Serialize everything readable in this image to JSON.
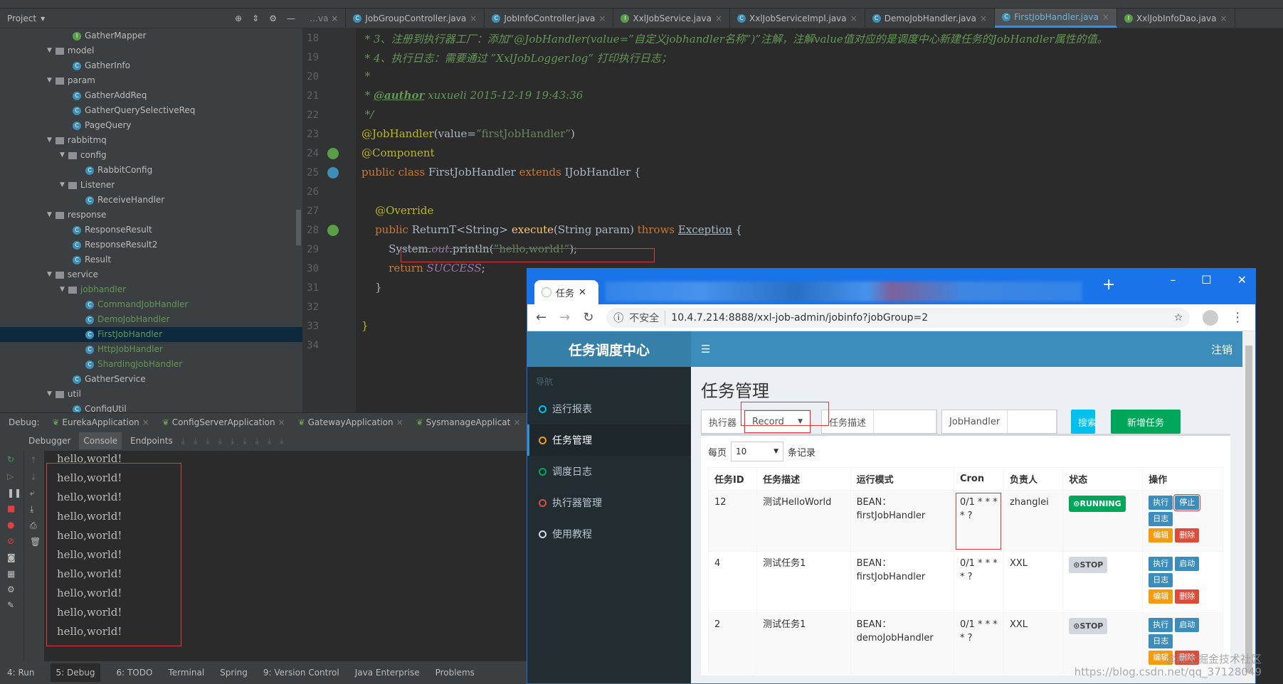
{
  "ide": {
    "project_label": "Project",
    "tree": [
      {
        "label": "GatherMapper",
        "kind": "interface",
        "depth": 3
      },
      {
        "label": "model",
        "kind": "folder",
        "depth": 2
      },
      {
        "label": "GatherInfo",
        "kind": "class",
        "depth": 3
      },
      {
        "label": "param",
        "kind": "folder",
        "depth": 2
      },
      {
        "label": "GatherAddReq",
        "kind": "class",
        "depth": 3
      },
      {
        "label": "GatherQuerySelectiveReq",
        "kind": "class",
        "depth": 3
      },
      {
        "label": "PageQuery",
        "kind": "class",
        "depth": 3
      },
      {
        "label": "rabbitmq",
        "kind": "folder",
        "depth": 2
      },
      {
        "label": "config",
        "kind": "folder",
        "depth": 3
      },
      {
        "label": "RabbitConfig",
        "kind": "class",
        "depth": 4
      },
      {
        "label": "Listener",
        "kind": "folder",
        "depth": 3
      },
      {
        "label": "ReceiveHandler",
        "kind": "class",
        "depth": 4
      },
      {
        "label": "response",
        "kind": "folder",
        "depth": 2
      },
      {
        "label": "ResponseResult",
        "kind": "class",
        "depth": 3
      },
      {
        "label": "ResponseResult2",
        "kind": "class",
        "depth": 3
      },
      {
        "label": "Result",
        "kind": "class",
        "depth": 3
      },
      {
        "label": "service",
        "kind": "folder",
        "depth": 2
      },
      {
        "label": "jobhandler",
        "kind": "folder",
        "depth": 3,
        "green": true
      },
      {
        "label": "CommandJobHandler",
        "kind": "class",
        "depth": 4,
        "green": true
      },
      {
        "label": "DemoJobHandler",
        "kind": "class",
        "depth": 4,
        "green": true
      },
      {
        "label": "FirstJobHandler",
        "kind": "class",
        "depth": 4,
        "green": true,
        "selected": true
      },
      {
        "label": "HttpJobHandler",
        "kind": "class",
        "depth": 4,
        "green": true
      },
      {
        "label": "ShardingJobHandler",
        "kind": "class",
        "depth": 4,
        "green": true
      },
      {
        "label": "GatherService",
        "kind": "class",
        "depth": 3
      },
      {
        "label": "util",
        "kind": "folder",
        "depth": 2
      },
      {
        "label": "ConfigUtil",
        "kind": "class",
        "depth": 3
      }
    ],
    "tabs": [
      {
        "label": "JobGroupController.java",
        "kind": "class"
      },
      {
        "label": "JobInfoController.java",
        "kind": "class"
      },
      {
        "label": "XxlJobService.java",
        "kind": "interface"
      },
      {
        "label": "XxlJobServiceImpl.java",
        "kind": "class"
      },
      {
        "label": "DemoJobHandler.java",
        "kind": "class"
      },
      {
        "label": "FirstJobHandler.java",
        "kind": "class",
        "active": true
      },
      {
        "label": "XxlJobInfoDao.java",
        "kind": "interface"
      }
    ],
    "code_lines": [
      {
        "n": "18",
        "html": "<span class='cm'> * 3、注册到执行器工厂：添加“@JobHandler(value=”自定义jobhandler名称”)”注解，注解value值对应的是调度中心新建任务的JobHandler属性的值。</span>"
      },
      {
        "n": "19",
        "html": "<span class='cm'> * 4、执行日志：需要通过 ”XxlJobLogger.log” 打印执行日志；</span>"
      },
      {
        "n": "20",
        "html": "<span class='cm'> *</span>"
      },
      {
        "n": "21",
        "html": "<span class='cm'> * <u><b>@author</b></u> xuxueli 2015-12-19 19:43:36</span>"
      },
      {
        "n": "22",
        "html": "<span class='cm'> */</span>"
      },
      {
        "n": "23",
        "html": "<span class='an'>@JobHandler</span>(value=<span class='str'>”firstJobHandler”</span>)"
      },
      {
        "n": "24",
        "html": "<span class='an'>@Component</span>"
      },
      {
        "n": "25",
        "html": "<span class='kw'>public class</span> FirstJobHandler <span class='kw'>extends</span> IJobHandler {"
      },
      {
        "n": "26",
        "html": ""
      },
      {
        "n": "27",
        "html": "    <span class='an'>@Override</span>"
      },
      {
        "n": "28",
        "html": "    <span class='kw'>public</span> ReturnT&lt;String&gt; <span class='fn'>execute</span>(String param) <span class='kw'>throws</span> <u>Exception</u> {"
      },
      {
        "n": "29",
        "html": "        System.<span class='st'>out</span>.println(<span class='str'>”hello,world!”</span>);"
      },
      {
        "n": "30",
        "html": "        <span class='kw'>return</span> <span class='st'>SUCCESS</span>;"
      },
      {
        "n": "31",
        "html": "    }"
      },
      {
        "n": "32",
        "html": ""
      },
      {
        "n": "33",
        "html": "<span class='an'>}</span>"
      },
      {
        "n": "34",
        "html": ""
      }
    ],
    "debug_label": "Debug:",
    "debug_sessions": [
      "EurekaApplication",
      "ConfigServerApplication",
      "GatewayApplication",
      "SysmanageApplicat"
    ],
    "debug_tabs": [
      "Debugger",
      "Console",
      "Endpoints"
    ],
    "console_lines": [
      "hello,world!",
      "hello,world!",
      "hello,world!",
      "hello,world!",
      "hello,world!",
      "hello,world!",
      "hello,world!",
      "hello,world!",
      "hello,world!",
      "hello,world!"
    ],
    "status_tabs": [
      "4: Run",
      "5: Debug",
      "6: TODO",
      "Terminal",
      "Spring",
      "9: Version Control",
      "Java Enterprise",
      "Problems"
    ]
  },
  "browser": {
    "tab_title": "任务",
    "new_tab": "+",
    "not_secure": "不安全",
    "url": "10.4.7.214:8888/xxl-job-admin/jobinfo?jobGroup=2",
    "app": {
      "logo": "任务调度中心",
      "logout": "注销",
      "nav_header": "导航",
      "nav": [
        {
          "label": "运行报表",
          "color": "#00c0ef"
        },
        {
          "label": "任务管理",
          "color": "#f39c12",
          "active": true
        },
        {
          "label": "调度日志",
          "color": "#00a65a"
        },
        {
          "label": "执行器管理",
          "color": "#dd4b39"
        },
        {
          "label": "使用教程",
          "color": "#d2d6de"
        }
      ],
      "page_title": "任务管理",
      "executor_label": "执行器",
      "executor_value": "Record",
      "desc_label": "任务描述",
      "handler_label": "JobHandler",
      "search_btn": "搜索",
      "add_btn": "新增任务",
      "per_page_label": "每页",
      "per_page_value": "10",
      "records_label": "条记录",
      "columns": [
        "任务ID",
        "任务描述",
        "运行模式",
        "Cron",
        "负责人",
        "状态",
        "操作"
      ],
      "rows": [
        {
          "id": "12",
          "desc": "测试HelloWorld",
          "mode": "BEAN：",
          "handler": "firstJobHandler",
          "cron": "0/1 * * * * ?",
          "owner": "zhanglei",
          "status": "RUNNING",
          "toggle": "停止"
        },
        {
          "id": "4",
          "desc": "测试任务1",
          "mode": "BEAN：",
          "handler": "firstJobHandler",
          "cron": "0/1 * * * * ?",
          "owner": "XXL",
          "status": "STOP",
          "toggle": "启动"
        },
        {
          "id": "2",
          "desc": "测试任务1",
          "mode": "BEAN：",
          "handler": "demoJobHandler",
          "cron": "0/1 * * * * ?",
          "owner": "XXL",
          "status": "STOP",
          "toggle": "启动"
        }
      ],
      "op_run": "执行",
      "op_log": "日志",
      "op_edit": "编辑",
      "op_delete": "删除"
    }
  },
  "watermark": [
    "@稀土掘金技术社区",
    "https://blog.csdn.net/qq_37128049"
  ],
  "colors": {
    "running": "#00a65a",
    "stop": "#d2d6de",
    "primary": "#3c8dbc",
    "warning": "#f39c12",
    "danger": "#dd4b39",
    "info": "#00c0ef",
    "success": "#00a65a"
  }
}
